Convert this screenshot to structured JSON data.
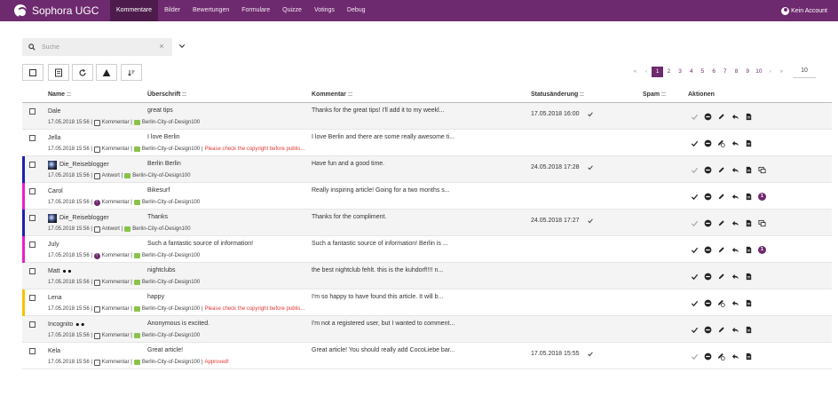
{
  "app": {
    "brand": "Sophora UGC",
    "account_label": "Kein Account"
  },
  "nav": {
    "items": [
      {
        "label": "Kommentare",
        "active": true
      },
      {
        "label": "Bilder",
        "active": false
      },
      {
        "label": "Bewertungen",
        "active": false
      },
      {
        "label": "Formulare",
        "active": false
      },
      {
        "label": "Quizze",
        "active": false
      },
      {
        "label": "Votings",
        "active": false
      },
      {
        "label": "Debug",
        "active": false
      }
    ]
  },
  "search": {
    "placeholder": "Suche",
    "value": ""
  },
  "pagination": {
    "prev_first": "«",
    "prev": "‹",
    "pages": [
      "1",
      "2",
      "3",
      "4",
      "5",
      "6",
      "7",
      "8",
      "9",
      "10"
    ],
    "current": "1",
    "next": "›",
    "next_last": "»",
    "per_page": "10"
  },
  "table": {
    "headers": {
      "name": "Name",
      "headline": "Überschrift",
      "comment": "Kommentar",
      "status": "Statusänderung",
      "spam": "Spam",
      "actions": "Aktionen"
    },
    "rows": [
      {
        "marker": "",
        "avatar": false,
        "name": "Dale",
        "glasses": false,
        "date": "17.05.2018 15:56",
        "type": "Kommentar",
        "type_icon": "chat",
        "section": "Berlin-City-of-Design100",
        "note": "",
        "headline": "great tips",
        "comment": "Thanks for the great tips! I'll add it to my weekl...",
        "status_date": "17.05.2018 16:00",
        "status_checked": true,
        "shaded": true,
        "edit_variant": "pencil",
        "extra": ""
      },
      {
        "marker": "",
        "avatar": false,
        "name": "Jella",
        "glasses": false,
        "date": "17.05.2018 15:56",
        "type": "Kommentar",
        "type_icon": "chat",
        "section": "Berlin-City-of-Design100",
        "note": "Please check the copyright before publis...",
        "headline": "I love Berlin",
        "comment": "I love Berlin and there are some really awesome ti...",
        "status_date": "",
        "status_checked": false,
        "shaded": false,
        "edit_variant": "pencil-flag",
        "extra": ""
      },
      {
        "marker": "#1f1fb0",
        "avatar": true,
        "name": "Die_Reiseblogger",
        "glasses": false,
        "date": "17.05.2018 15:56",
        "type": "Antwort",
        "type_icon": "chat",
        "section": "Berlin-City-of-Design100",
        "note": "",
        "headline": "Berlin Berlin",
        "comment": "Have fun and a good time.",
        "status_date": "24.05.2018 17:28",
        "status_checked": true,
        "shaded": true,
        "edit_variant": "pencil",
        "extra": "reply-thread"
      },
      {
        "marker": "#e91ec8",
        "avatar": false,
        "name": "Carol",
        "glasses": false,
        "date": "17.05.2018 15:56",
        "type": "Kommentar",
        "type_icon": "reply",
        "section": "Berlin-City-of-Design100",
        "note": "",
        "headline": "Bikesurf",
        "comment": "Really inspiring article! Going for a two months s...",
        "status_date": "",
        "status_checked": false,
        "shaded": false,
        "edit_variant": "pencil",
        "extra": "1"
      },
      {
        "marker": "#1f1fb0",
        "avatar": true,
        "name": "Die_Reiseblogger",
        "glasses": false,
        "date": "17.05.2018 15:56",
        "type": "Antwort",
        "type_icon": "chat",
        "section": "Berlin-City-of-Design100",
        "note": "",
        "headline": "Thanks",
        "comment": "Thanks for the compliment.",
        "status_date": "24.05.2018 17:27",
        "status_checked": true,
        "shaded": true,
        "edit_variant": "pencil",
        "extra": "reply-thread"
      },
      {
        "marker": "#e91ec8",
        "avatar": false,
        "name": "July",
        "glasses": false,
        "date": "17.05.2018 15:56",
        "type": "Kommentar",
        "type_icon": "reply",
        "section": "Berlin-City-of-Design100",
        "note": "",
        "headline": "Such a fantastic source of information!",
        "comment": "Such a fantastic source of information! Berlin is ...",
        "status_date": "",
        "status_checked": false,
        "shaded": false,
        "edit_variant": "pencil",
        "extra": "1"
      },
      {
        "marker": "",
        "avatar": false,
        "name": "Matt",
        "glasses": true,
        "date": "17.05.2018 15:56",
        "type": "Kommentar",
        "type_icon": "chat",
        "section": "Berlin-City-of-Design100",
        "note": "",
        "headline": "nightclubs",
        "comment": "the best nightclub fehlt. this is the kuhdorf!!!! n...",
        "status_date": "",
        "status_checked": false,
        "shaded": true,
        "edit_variant": "pencil",
        "extra": ""
      },
      {
        "marker": "#f5c400",
        "avatar": false,
        "name": "Lena",
        "glasses": false,
        "date": "17.05.2018 15:56",
        "type": "Kommentar",
        "type_icon": "chat",
        "section": "Berlin-City-of-Design100",
        "note": "Please check the copyright before publis...",
        "headline": "happy",
        "comment": "I'm so happy to have found this article. It will b...",
        "status_date": "",
        "status_checked": false,
        "shaded": false,
        "edit_variant": "pencil-flag",
        "extra": ""
      },
      {
        "marker": "",
        "avatar": false,
        "name": "Incognito",
        "glasses": true,
        "date": "17.05.2018 15:56",
        "type": "Kommentar",
        "type_icon": "chat",
        "section": "Berlin-City-of-Design100",
        "note": "",
        "headline": "Anonymous is excited.",
        "comment": "I'm not a registered user, but I wanted to comment...",
        "status_date": "",
        "status_checked": false,
        "shaded": true,
        "edit_variant": "pencil",
        "extra": ""
      },
      {
        "marker": "",
        "avatar": false,
        "name": "Kela",
        "glasses": false,
        "date": "17.05.2018 15:56",
        "type": "Kommentar",
        "type_icon": "chat",
        "section": "Berlin-City-of-Design100",
        "note": "Approved!",
        "headline": "Great article!",
        "comment": "Great article! You should really add CocoLiebe bar...",
        "status_date": "17.05.2018 15:55",
        "status_checked": true,
        "shaded": false,
        "edit_variant": "pencil-flag",
        "extra": ""
      }
    ]
  },
  "colors": {
    "brand": "#6e2a6e",
    "brand_dark": "#4d1c4d",
    "warning": "#e53935",
    "leaf": "#8bc34a"
  }
}
